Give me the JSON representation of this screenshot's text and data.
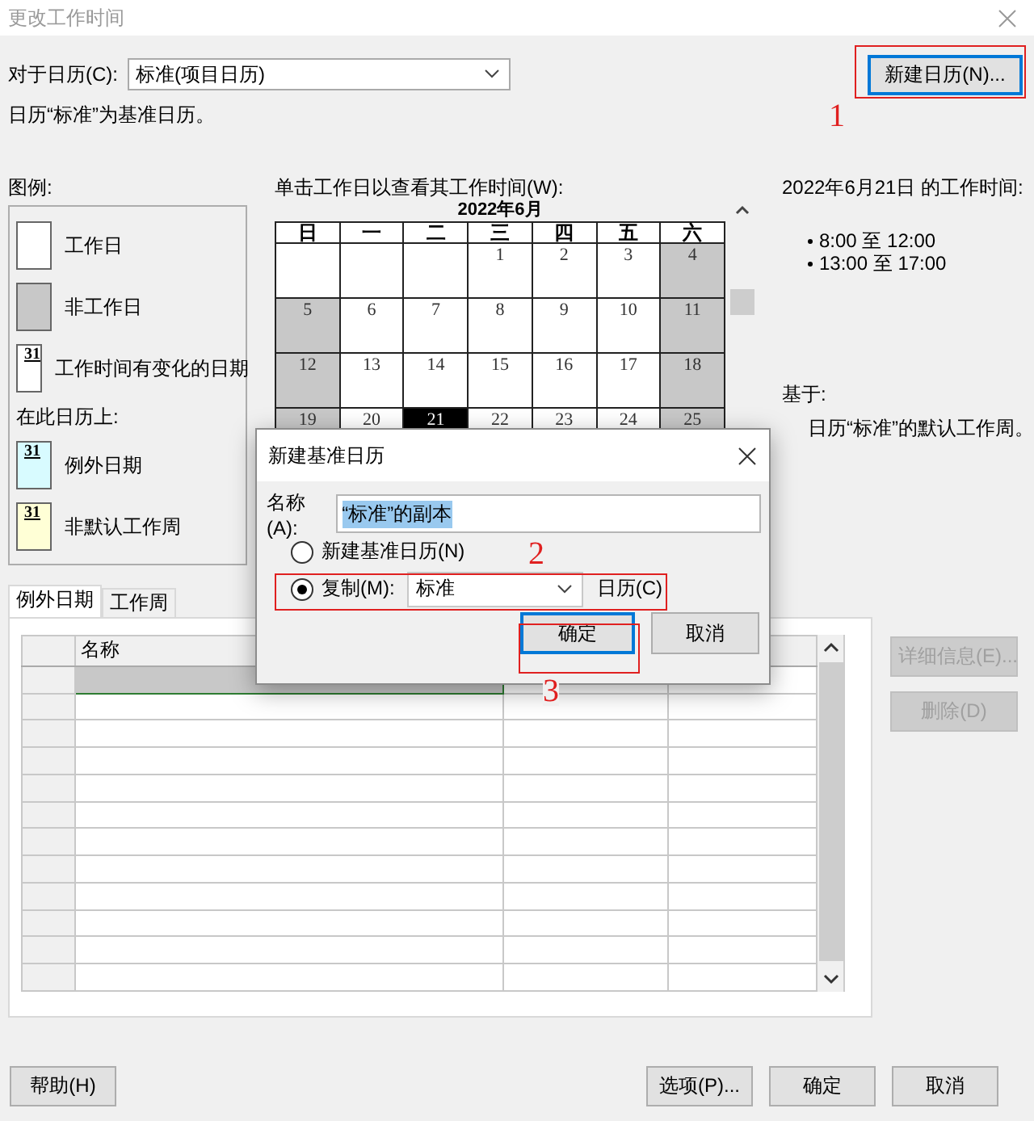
{
  "window": {
    "title": "更改工作时间"
  },
  "calendar_select": {
    "label": "对于日历(C):",
    "value": "标准(项目日历)"
  },
  "new_calendar_button": "新建日历(N)...",
  "base_note": "日历“标准”为基准日历。",
  "legend": {
    "title": "图例:",
    "items": [
      {
        "kind": "working",
        "label": "工作日"
      },
      {
        "kind": "nonworking",
        "label": "非工作日"
      },
      {
        "kind": "changed",
        "mark": "31",
        "label": "工作时间有变化的日期"
      }
    ],
    "subtitle": "在此日历上:",
    "calendar_items": [
      {
        "kind": "exception",
        "mark": "31",
        "label": "例外日期"
      },
      {
        "kind": "nondefault",
        "mark": "31",
        "label": "非默认工作周"
      }
    ]
  },
  "calendar": {
    "prompt": "单击工作日以查看其工作时间(W):",
    "month": "2022年6月",
    "weekdays": [
      "日",
      "一",
      "二",
      "三",
      "四",
      "五",
      "六"
    ],
    "weeks": [
      [
        {
          "kind": "blank"
        },
        {
          "kind": "blank"
        },
        {
          "kind": "blank"
        },
        {
          "kind": "day",
          "day": "1",
          "working": true,
          "selected": false
        },
        {
          "kind": "day",
          "day": "2",
          "working": true,
          "selected": false
        },
        {
          "kind": "day",
          "day": "3",
          "working": true,
          "selected": false
        },
        {
          "kind": "day",
          "day": "4",
          "working": false,
          "selected": false
        }
      ],
      [
        {
          "kind": "day",
          "day": "5",
          "working": false,
          "selected": false
        },
        {
          "kind": "day",
          "day": "6",
          "working": true,
          "selected": false
        },
        {
          "kind": "day",
          "day": "7",
          "working": true,
          "selected": false
        },
        {
          "kind": "day",
          "day": "8",
          "working": true,
          "selected": false
        },
        {
          "kind": "day",
          "day": "9",
          "working": true,
          "selected": false
        },
        {
          "kind": "day",
          "day": "10",
          "working": true,
          "selected": false
        },
        {
          "kind": "day",
          "day": "11",
          "working": false,
          "selected": false
        }
      ],
      [
        {
          "kind": "day",
          "day": "12",
          "working": false,
          "selected": false
        },
        {
          "kind": "day",
          "day": "13",
          "working": true,
          "selected": false
        },
        {
          "kind": "day",
          "day": "14",
          "working": true,
          "selected": false
        },
        {
          "kind": "day",
          "day": "15",
          "working": true,
          "selected": false
        },
        {
          "kind": "day",
          "day": "16",
          "working": true,
          "selected": false
        },
        {
          "kind": "day",
          "day": "17",
          "working": true,
          "selected": false
        },
        {
          "kind": "day",
          "day": "18",
          "working": false,
          "selected": false
        }
      ],
      [
        {
          "kind": "day",
          "day": "19",
          "working": false,
          "selected": false
        },
        {
          "kind": "day",
          "day": "20",
          "working": true,
          "selected": false
        },
        {
          "kind": "day",
          "day": "21",
          "working": true,
          "selected": true
        },
        {
          "kind": "day",
          "day": "22",
          "working": true,
          "selected": false
        },
        {
          "kind": "day",
          "day": "23",
          "working": true,
          "selected": false
        },
        {
          "kind": "day",
          "day": "24",
          "working": true,
          "selected": false
        },
        {
          "kind": "day",
          "day": "25",
          "working": false,
          "selected": false
        }
      ]
    ]
  },
  "working_times": {
    "title": "2022年6月21日 的工作时间:",
    "items": [
      "8:00 至 12:00",
      "13:00 至 17:00"
    ],
    "based_on_label": "基于:",
    "based_on": "日历“标准”的默认工作周。"
  },
  "tabs": [
    {
      "label": "例外日期",
      "selected": true
    },
    {
      "label": "工作周",
      "selected": false
    }
  ],
  "exceptions_table": {
    "columns": [
      "名称"
    ],
    "rows": [
      {
        "selected": true
      },
      {
        "selected": false
      },
      {
        "selected": false
      },
      {
        "selected": false
      },
      {
        "selected": false
      },
      {
        "selected": false
      },
      {
        "selected": false
      },
      {
        "selected": false
      },
      {
        "selected": false
      },
      {
        "selected": false
      },
      {
        "selected": false
      },
      {
        "selected": false
      }
    ]
  },
  "side_buttons": [
    {
      "label": "详细信息(E)...",
      "disabled": true
    },
    {
      "label": "删除(D)",
      "disabled": true
    }
  ],
  "help_button": "帮助(H)",
  "footer_buttons": [
    "选项(P)...",
    "确定",
    "取消"
  ],
  "new_base_dialog": {
    "title": "新建基准日历",
    "name_label": "名称(A):",
    "name_value": "“标准”的副本",
    "options": [
      {
        "label": "新建基准日历(N)",
        "selected": false
      },
      {
        "label": "复制(M):",
        "selected": true
      }
    ],
    "copy_from": "标准",
    "copy_suffix": "日历(C)",
    "ok": "确定",
    "cancel": "取消"
  },
  "annotations": [
    {
      "number": "1"
    },
    {
      "number": "2"
    },
    {
      "number": "3"
    }
  ]
}
